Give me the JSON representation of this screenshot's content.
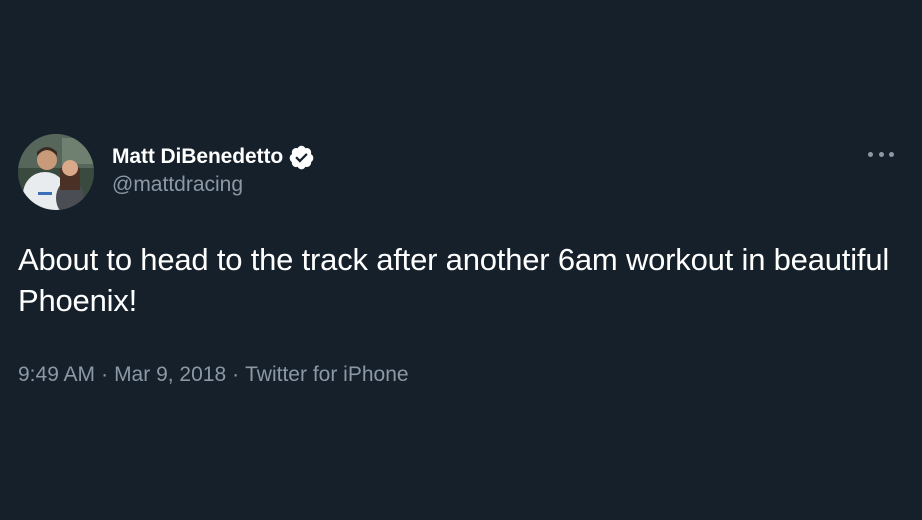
{
  "tweet": {
    "display_name": "Matt DiBenedetto",
    "handle": "@mattdracing",
    "verified": true,
    "text": "About to head to the track after another 6am workout in beautiful Phoenix!",
    "time": "9:49 AM",
    "separator": "·",
    "date": "Mar 9, 2018",
    "source": "Twitter for iPhone"
  },
  "colors": {
    "background": "#15202b",
    "primary_text": "#ffffff",
    "secondary_text": "#8b98a5"
  },
  "icons": {
    "verified": "verified-badge-icon",
    "more": "more-options-icon"
  }
}
